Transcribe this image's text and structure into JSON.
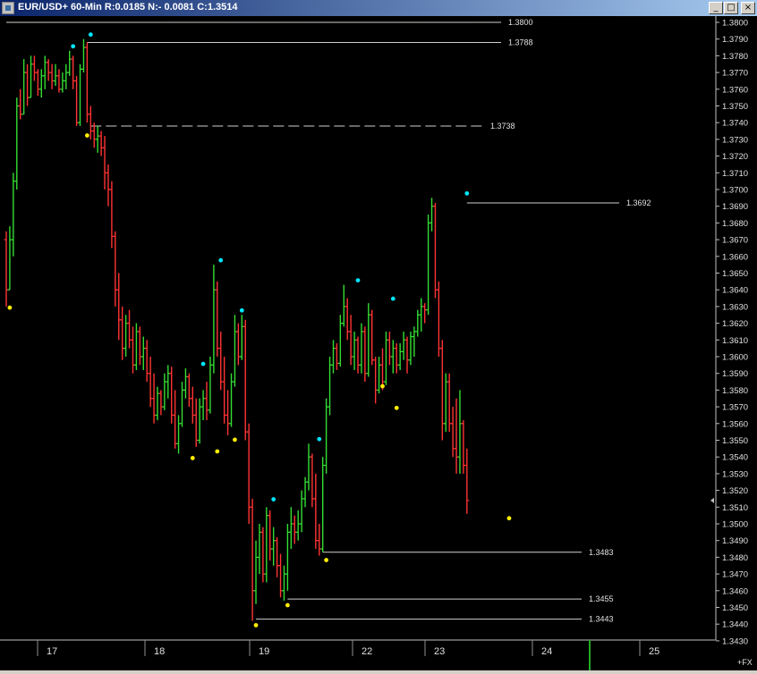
{
  "window": {
    "title": "EUR/USD+ 60-Min R:0.0185 N:- 0.0081 C:1.3514",
    "icon": "chart-app-icon",
    "buttons": {
      "minimize": "_",
      "maximize": "□",
      "close": "×"
    }
  },
  "colors": {
    "background": "#000000",
    "up_bar": "#33dd33",
    "down_bar": "#ff3333",
    "swing_high": "#00e5ff",
    "swing_low": "#ffee00",
    "level_line": "#d0d0d0",
    "axis_text": "#e0e0e0",
    "current_price_marker": "#22aa22"
  },
  "chart_data": {
    "type": "ohlc-bar",
    "symbol": "EUR/USD+",
    "timeframe": "60-Min",
    "header_stats": {
      "R": "0.0185",
      "N": "- 0.0081",
      "C": "1.3514"
    },
    "price_axis": {
      "range": [
        1.343,
        1.3805
      ],
      "tick_step": 0.001,
      "tick_labels": [
        "1.3800",
        "1.3790",
        "1.3780",
        "1.3770",
        "1.3760",
        "1.3750",
        "1.3740",
        "1.3730",
        "1.3720",
        "1.3710",
        "1.3700",
        "1.3690",
        "1.3680",
        "1.3670",
        "1.3660",
        "1.3650",
        "1.3640",
        "1.3630",
        "1.3620",
        "1.3610",
        "1.3600",
        "1.3590",
        "1.3580",
        "1.3570",
        "1.3560",
        "1.3550",
        "1.3540",
        "1.3530",
        "1.3520",
        "1.3510",
        "1.3500",
        "1.3490",
        "1.3480",
        "1.3470",
        "1.3460",
        "1.3450",
        "1.3440",
        "1.3430"
      ],
      "current_price": 1.3514
    },
    "time_axis": {
      "labels": [
        "17",
        "18",
        "19",
        "22",
        "23",
        "24",
        "25"
      ],
      "corner_label": "+FX"
    },
    "levels": [
      {
        "label": "1.3800",
        "value": 1.38,
        "style": "solid",
        "from_bar": 0
      },
      {
        "label": "1.3788",
        "value": 1.3788,
        "style": "solid",
        "from_bar": 23
      },
      {
        "label": "1.3738",
        "value": 1.3738,
        "style": "dashed",
        "from_bar": 24
      },
      {
        "label": "1.3692",
        "value": 1.3692,
        "style": "solid",
        "from_bar": 131
      },
      {
        "label": "1.3483",
        "value": 1.3483,
        "style": "solid",
        "from_bar": 90
      },
      {
        "label": "1.3455",
        "value": 1.3455,
        "style": "solid",
        "from_bar": 80
      },
      {
        "label": "1.3443",
        "value": 1.3443,
        "style": "solid",
        "from_bar": 71
      }
    ],
    "markers": {
      "swing_highs": [
        [
          19,
          1.3783
        ],
        [
          24,
          1.379
        ],
        [
          56,
          1.3593
        ],
        [
          61,
          1.3655
        ],
        [
          67,
          1.3625
        ],
        [
          76,
          1.3512
        ],
        [
          89,
          1.3548
        ],
        [
          100,
          1.3643
        ],
        [
          110,
          1.3632
        ],
        [
          131,
          1.3695
        ]
      ],
      "swing_lows": [
        [
          1,
          1.3632
        ],
        [
          23,
          1.3735
        ],
        [
          53,
          1.3542
        ],
        [
          60,
          1.3546
        ],
        [
          65,
          1.3553
        ],
        [
          71,
          1.3442
        ],
        [
          80,
          1.3454
        ],
        [
          91,
          1.3481
        ],
        [
          107,
          1.3585
        ],
        [
          111,
          1.3572
        ],
        [
          143,
          1.3506
        ]
      ]
    },
    "bars": [
      [
        1.367,
        1.3675,
        1.363,
        1.364
      ],
      [
        1.364,
        1.3678,
        1.364,
        1.367
      ],
      [
        1.367,
        1.371,
        1.366,
        1.3705
      ],
      [
        1.3705,
        1.3755,
        1.37,
        1.375
      ],
      [
        1.375,
        1.376,
        1.3742,
        1.3745
      ],
      [
        1.3745,
        1.3778,
        1.3745,
        1.377
      ],
      [
        1.377,
        1.3775,
        1.375,
        1.3755
      ],
      [
        1.3755,
        1.378,
        1.3755,
        1.3775
      ],
      [
        1.3775,
        1.378,
        1.3765,
        1.377
      ],
      [
        1.377,
        1.3772,
        1.3756,
        1.376
      ],
      [
        1.376,
        1.3772,
        1.3755,
        1.3768
      ],
      [
        1.3768,
        1.378,
        1.376,
        1.3776
      ],
      [
        1.3776,
        1.3778,
        1.3765,
        1.377
      ],
      [
        1.377,
        1.3775,
        1.376,
        1.3765
      ],
      [
        1.3765,
        1.3775,
        1.3762,
        1.3768
      ],
      [
        1.3768,
        1.3772,
        1.3758,
        1.376
      ],
      [
        1.376,
        1.377,
        1.3758,
        1.3765
      ],
      [
        1.3765,
        1.3775,
        1.376,
        1.377
      ],
      [
        1.377,
        1.3783,
        1.3768,
        1.3778
      ],
      [
        1.3778,
        1.378,
        1.376,
        1.3765
      ],
      [
        1.3765,
        1.3768,
        1.3738,
        1.374
      ],
      [
        1.374,
        1.3775,
        1.3738,
        1.3772
      ],
      [
        1.3772,
        1.379,
        1.377,
        1.3785
      ],
      [
        1.3785,
        1.3788,
        1.374,
        1.3745
      ],
      [
        1.3745,
        1.375,
        1.373,
        1.3735
      ],
      [
        1.3735,
        1.374,
        1.3725,
        1.373
      ],
      [
        1.373,
        1.3738,
        1.3722,
        1.3732
      ],
      [
        1.3732,
        1.3735,
        1.372,
        1.3725
      ],
      [
        1.3725,
        1.3732,
        1.37,
        1.371
      ],
      [
        1.371,
        1.3715,
        1.369,
        1.37
      ],
      [
        1.37,
        1.3705,
        1.3665,
        1.3672
      ],
      [
        1.3672,
        1.3675,
        1.363,
        1.364
      ],
      [
        1.364,
        1.365,
        1.361,
        1.3622
      ],
      [
        1.3622,
        1.363,
        1.3598,
        1.3605
      ],
      [
        1.3605,
        1.3625,
        1.36,
        1.362
      ],
      [
        1.362,
        1.3628,
        1.3605,
        1.361
      ],
      [
        1.361,
        1.3618,
        1.359,
        1.3595
      ],
      [
        1.3595,
        1.362,
        1.3592,
        1.3615
      ],
      [
        1.3615,
        1.3618,
        1.3595,
        1.36
      ],
      [
        1.36,
        1.3612,
        1.3592,
        1.3605
      ],
      [
        1.3605,
        1.361,
        1.3585,
        1.359
      ],
      [
        1.359,
        1.36,
        1.357,
        1.3575
      ],
      [
        1.3575,
        1.359,
        1.356,
        1.3565
      ],
      [
        1.3565,
        1.3582,
        1.3562,
        1.3578
      ],
      [
        1.3578,
        1.358,
        1.3565,
        1.357
      ],
      [
        1.357,
        1.359,
        1.3568,
        1.3585
      ],
      [
        1.3585,
        1.3595,
        1.3575,
        1.359
      ],
      [
        1.359,
        1.3594,
        1.356,
        1.3565
      ],
      [
        1.3565,
        1.358,
        1.3545,
        1.3548
      ],
      [
        1.3548,
        1.3565,
        1.3542,
        1.356
      ],
      [
        1.356,
        1.3585,
        1.3558,
        1.358
      ],
      [
        1.358,
        1.3593,
        1.3575,
        1.3588
      ],
      [
        1.3588,
        1.359,
        1.357,
        1.3575
      ],
      [
        1.3575,
        1.3582,
        1.356,
        1.3565
      ],
      [
        1.3565,
        1.3575,
        1.3546,
        1.355
      ],
      [
        1.355,
        1.3575,
        1.3548,
        1.357
      ],
      [
        1.357,
        1.358,
        1.3562,
        1.3575
      ],
      [
        1.3575,
        1.3585,
        1.3562,
        1.3568
      ],
      [
        1.3568,
        1.36,
        1.3566,
        1.3595
      ],
      [
        1.3595,
        1.3655,
        1.359,
        1.364
      ],
      [
        1.364,
        1.3645,
        1.36,
        1.3605
      ],
      [
        1.3605,
        1.3615,
        1.358,
        1.3585
      ],
      [
        1.3585,
        1.36,
        1.356,
        1.3565
      ],
      [
        1.3565,
        1.358,
        1.3553,
        1.356
      ],
      [
        1.356,
        1.359,
        1.3558,
        1.3585
      ],
      [
        1.3585,
        1.3625,
        1.3582,
        1.3615
      ],
      [
        1.3615,
        1.362,
        1.3595,
        1.36
      ],
      [
        1.36,
        1.3625,
        1.3598,
        1.3618
      ],
      [
        1.3618,
        1.3622,
        1.355,
        1.3555
      ],
      [
        1.3555,
        1.356,
        1.35,
        1.351
      ],
      [
        1.351,
        1.3515,
        1.3442,
        1.346
      ],
      [
        1.346,
        1.349,
        1.3452,
        1.348
      ],
      [
        1.348,
        1.35,
        1.347,
        1.3495
      ],
      [
        1.3495,
        1.3498,
        1.3465,
        1.347
      ],
      [
        1.347,
        1.351,
        1.3465,
        1.3505
      ],
      [
        1.3505,
        1.3508,
        1.3478,
        1.3485
      ],
      [
        1.3485,
        1.3498,
        1.3475,
        1.349
      ],
      [
        1.349,
        1.3492,
        1.3468,
        1.3475
      ],
      [
        1.3475,
        1.3482,
        1.3456,
        1.346
      ],
      [
        1.346,
        1.3475,
        1.3454,
        1.347
      ],
      [
        1.347,
        1.35,
        1.346,
        1.3495
      ],
      [
        1.3495,
        1.351,
        1.3485,
        1.35
      ],
      [
        1.35,
        1.3505,
        1.3488,
        1.3495
      ],
      [
        1.3495,
        1.3508,
        1.349,
        1.35
      ],
      [
        1.35,
        1.352,
        1.3495,
        1.3515
      ],
      [
        1.3515,
        1.3528,
        1.351,
        1.3525
      ],
      [
        1.3525,
        1.3548,
        1.352,
        1.354
      ],
      [
        1.354,
        1.3542,
        1.351,
        1.3515
      ],
      [
        1.3515,
        1.353,
        1.3485,
        1.349
      ],
      [
        1.349,
        1.35,
        1.3481,
        1.3485
      ],
      [
        1.3485,
        1.354,
        1.3483,
        1.3535
      ],
      [
        1.3535,
        1.3575,
        1.353,
        1.357
      ],
      [
        1.357,
        1.36,
        1.3565,
        1.3595
      ],
      [
        1.3595,
        1.361,
        1.359,
        1.3605
      ],
      [
        1.3605,
        1.3608,
        1.3592,
        1.3596
      ],
      [
        1.3596,
        1.3625,
        1.3594,
        1.362
      ],
      [
        1.362,
        1.3643,
        1.3618,
        1.363
      ],
      [
        1.363,
        1.3635,
        1.361,
        1.3615
      ],
      [
        1.3615,
        1.3625,
        1.3595,
        1.36
      ],
      [
        1.36,
        1.3615,
        1.3592,
        1.361
      ],
      [
        1.361,
        1.3612,
        1.359,
        1.3595
      ],
      [
        1.3595,
        1.362,
        1.359,
        1.3615
      ],
      [
        1.3615,
        1.3618,
        1.3585,
        1.359
      ],
      [
        1.359,
        1.3632,
        1.3588,
        1.3625
      ],
      [
        1.3625,
        1.3628,
        1.3595,
        1.3598
      ],
      [
        1.3598,
        1.36,
        1.3572,
        1.358
      ],
      [
        1.358,
        1.36,
        1.3578,
        1.3595
      ],
      [
        1.3595,
        1.3605,
        1.358,
        1.3585
      ],
      [
        1.3585,
        1.3615,
        1.3583,
        1.361
      ],
      [
        1.361,
        1.3615,
        1.3595,
        1.36
      ],
      [
        1.36,
        1.361,
        1.359,
        1.3605
      ],
      [
        1.3605,
        1.3608,
        1.359,
        1.3595
      ],
      [
        1.3595,
        1.3608,
        1.3592,
        1.3603
      ],
      [
        1.3603,
        1.3615,
        1.3598,
        1.361
      ],
      [
        1.361,
        1.3612,
        1.359,
        1.3598
      ],
      [
        1.3598,
        1.3615,
        1.3595,
        1.3612
      ],
      [
        1.3612,
        1.3618,
        1.36,
        1.3615
      ],
      [
        1.3615,
        1.3628,
        1.3612,
        1.3625
      ],
      [
        1.3625,
        1.3635,
        1.3615,
        1.363
      ],
      [
        1.363,
        1.3632,
        1.362,
        1.3628
      ],
      [
        1.3628,
        1.3685,
        1.3625,
        1.368
      ],
      [
        1.368,
        1.3695,
        1.3675,
        1.369
      ],
      [
        1.369,
        1.3692,
        1.3635,
        1.364
      ],
      [
        1.364,
        1.3645,
        1.36,
        1.3605
      ],
      [
        1.3605,
        1.361,
        1.355,
        1.356
      ],
      [
        1.356,
        1.359,
        1.3555,
        1.3585
      ],
      [
        1.3585,
        1.359,
        1.3555,
        1.356
      ],
      [
        1.356,
        1.357,
        1.354,
        1.3545
      ],
      [
        1.3545,
        1.3575,
        1.353,
        1.354
      ],
      [
        1.354,
        1.358,
        1.353,
        1.356
      ],
      [
        1.356,
        1.3562,
        1.353,
        1.3535
      ],
      [
        1.3535,
        1.3545,
        1.3506,
        1.3514
      ]
    ]
  }
}
